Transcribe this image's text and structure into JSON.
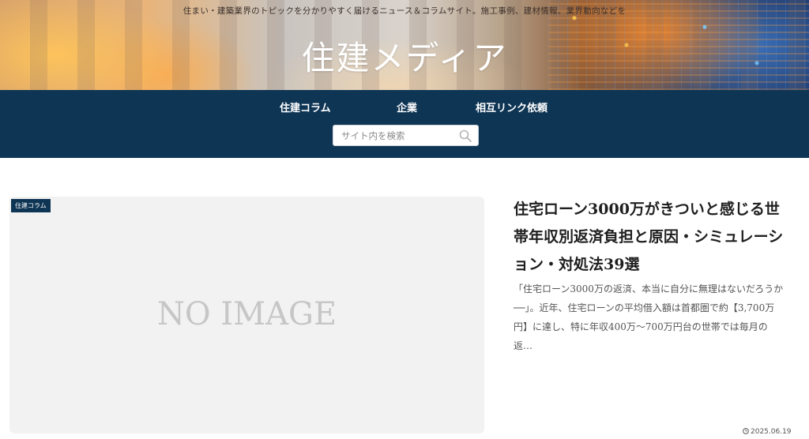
{
  "header": {
    "tagline": "住まい・建築業界のトピックを分かりやすく届けるニュース＆コラムサイト。施工事例、建材情報、業界動向などを",
    "logo_text": "住建メディア"
  },
  "nav": {
    "items": [
      {
        "label": "住建コラム"
      },
      {
        "label": "企業"
      },
      {
        "label": "相互リンク依頼"
      }
    ],
    "search": {
      "placeholder": "サイト内を検索",
      "icon": "search-icon"
    }
  },
  "article": {
    "category": "住建コラム",
    "thumbnail_text": "NO IMAGE",
    "title": "住宅ローン3000万がきついと感じる世帯年収別返済負担と原因・シミュレーション・対処法39選",
    "excerpt": "「住宅ローン3000万の返済、本当に自分に無理はないだろうか──」。近年、住宅ローンの平均借入額は首都圏で約【3,700万円】に達し、特に年収400万～700万円台の世帯では毎月の返…",
    "date": "2025.06.19"
  },
  "colors": {
    "nav_bg": "#0e3554",
    "category_bg": "#0e3554",
    "thumb_bg": "#f2f2f2"
  }
}
